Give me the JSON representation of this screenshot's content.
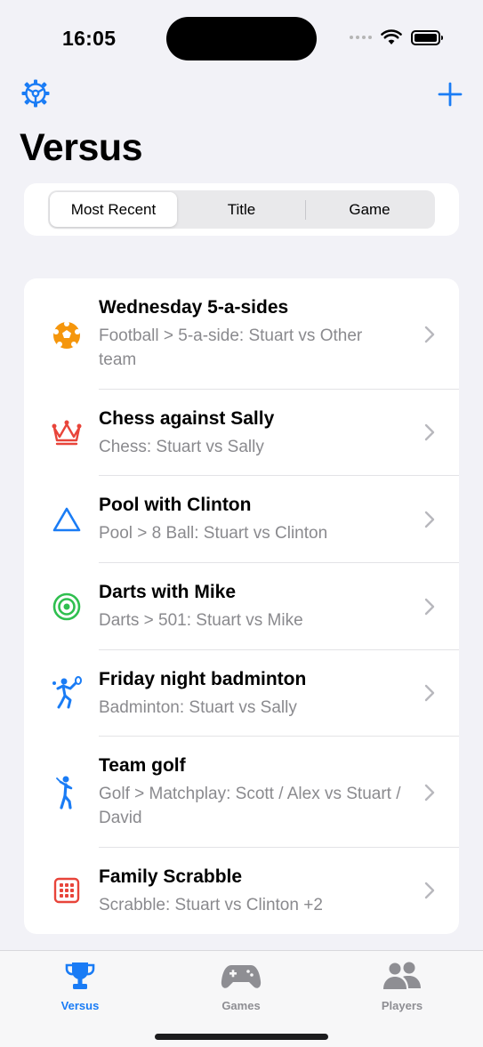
{
  "status_bar": {
    "time": "16:05"
  },
  "nav": {
    "title": "Versus",
    "settings_icon": "gear-icon",
    "add_icon": "plus-icon"
  },
  "colors": {
    "accent": "#1a7cf5",
    "secondary_text": "#8a8a8e",
    "background": "#f2f2f7"
  },
  "sort_control": {
    "options": [
      "Most Recent",
      "Title",
      "Game"
    ],
    "selected": "Most Recent"
  },
  "matches": [
    {
      "title": "Wednesday 5-a-sides",
      "subtitle": "Football > 5-a-side: Stuart vs Other team",
      "icon": "soccer-ball-icon",
      "icon_color": "#f5960c"
    },
    {
      "title": "Chess against Sally",
      "subtitle": "Chess: Stuart vs Sally",
      "icon": "crown-icon",
      "icon_color": "#e8443a"
    },
    {
      "title": "Pool with Clinton",
      "subtitle": "Pool > 8 Ball: Stuart vs Clinton",
      "icon": "triangle-icon",
      "icon_color": "#1a7cf5"
    },
    {
      "title": "Darts with Mike",
      "subtitle": "Darts > 501: Stuart vs Mike",
      "icon": "target-icon",
      "icon_color": "#2fbf4f"
    },
    {
      "title": "Friday night badminton",
      "subtitle": "Badminton: Stuart vs Sally",
      "icon": "badminton-player-icon",
      "icon_color": "#1a7cf5"
    },
    {
      "title": "Team golf",
      "subtitle": "Golf > Matchplay: Scott / Alex vs Stuart / David",
      "icon": "golfer-icon",
      "icon_color": "#1a7cf5"
    },
    {
      "title": "Family Scrabble",
      "subtitle": "Scrabble: Stuart vs Clinton +2",
      "icon": "grid-tiles-icon",
      "icon_color": "#e8443a"
    }
  ],
  "tab_bar": {
    "tabs": [
      {
        "label": "Versus",
        "icon": "trophy-icon",
        "active": true
      },
      {
        "label": "Games",
        "icon": "gamecontroller-icon",
        "active": false
      },
      {
        "label": "Players",
        "icon": "people-icon",
        "active": false
      }
    ]
  }
}
